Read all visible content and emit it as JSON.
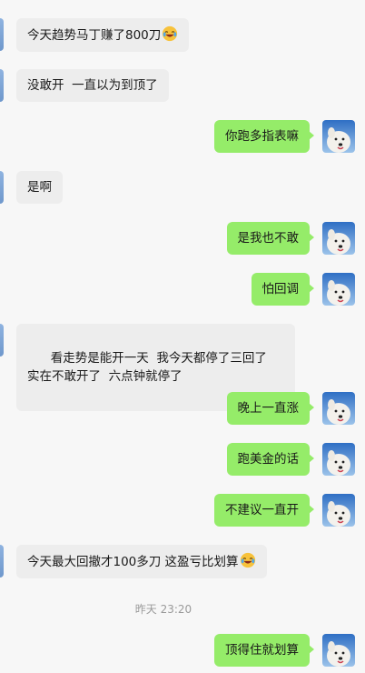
{
  "messages": [
    {
      "side": "in",
      "text": "今天趋势马丁赚了800刀",
      "emoji": "laugh-cry-emoji"
    },
    {
      "side": "in",
      "text": "没敢开  一直以为到顶了"
    },
    {
      "side": "out",
      "text": "你跑多指表嘛"
    },
    {
      "side": "in",
      "text": "是啊"
    },
    {
      "side": "out",
      "text": "是我也不敢"
    },
    {
      "side": "out",
      "text": "怕回调"
    },
    {
      "side": "in",
      "text": "看走势是能开一天  我今天都停了三回了  实在不敢开了  六点钟就停了"
    },
    {
      "side": "out",
      "text": "晚上一直涨"
    },
    {
      "side": "out",
      "text": "跑美金的话"
    },
    {
      "side": "out",
      "text": "不建议一直开"
    },
    {
      "side": "in",
      "text": "今天最大回撤才100多刀 这盈亏比划算",
      "emoji": "laugh-cry-emoji"
    },
    {
      "side": "time",
      "text": "昨天 23:20"
    },
    {
      "side": "out",
      "text": "顶得住就划算"
    }
  ],
  "colors": {
    "incoming_bubble": "#ededed",
    "outgoing_bubble": "#95ec69",
    "background": "#f7f7f7",
    "timestamp": "#9a9a9a"
  }
}
